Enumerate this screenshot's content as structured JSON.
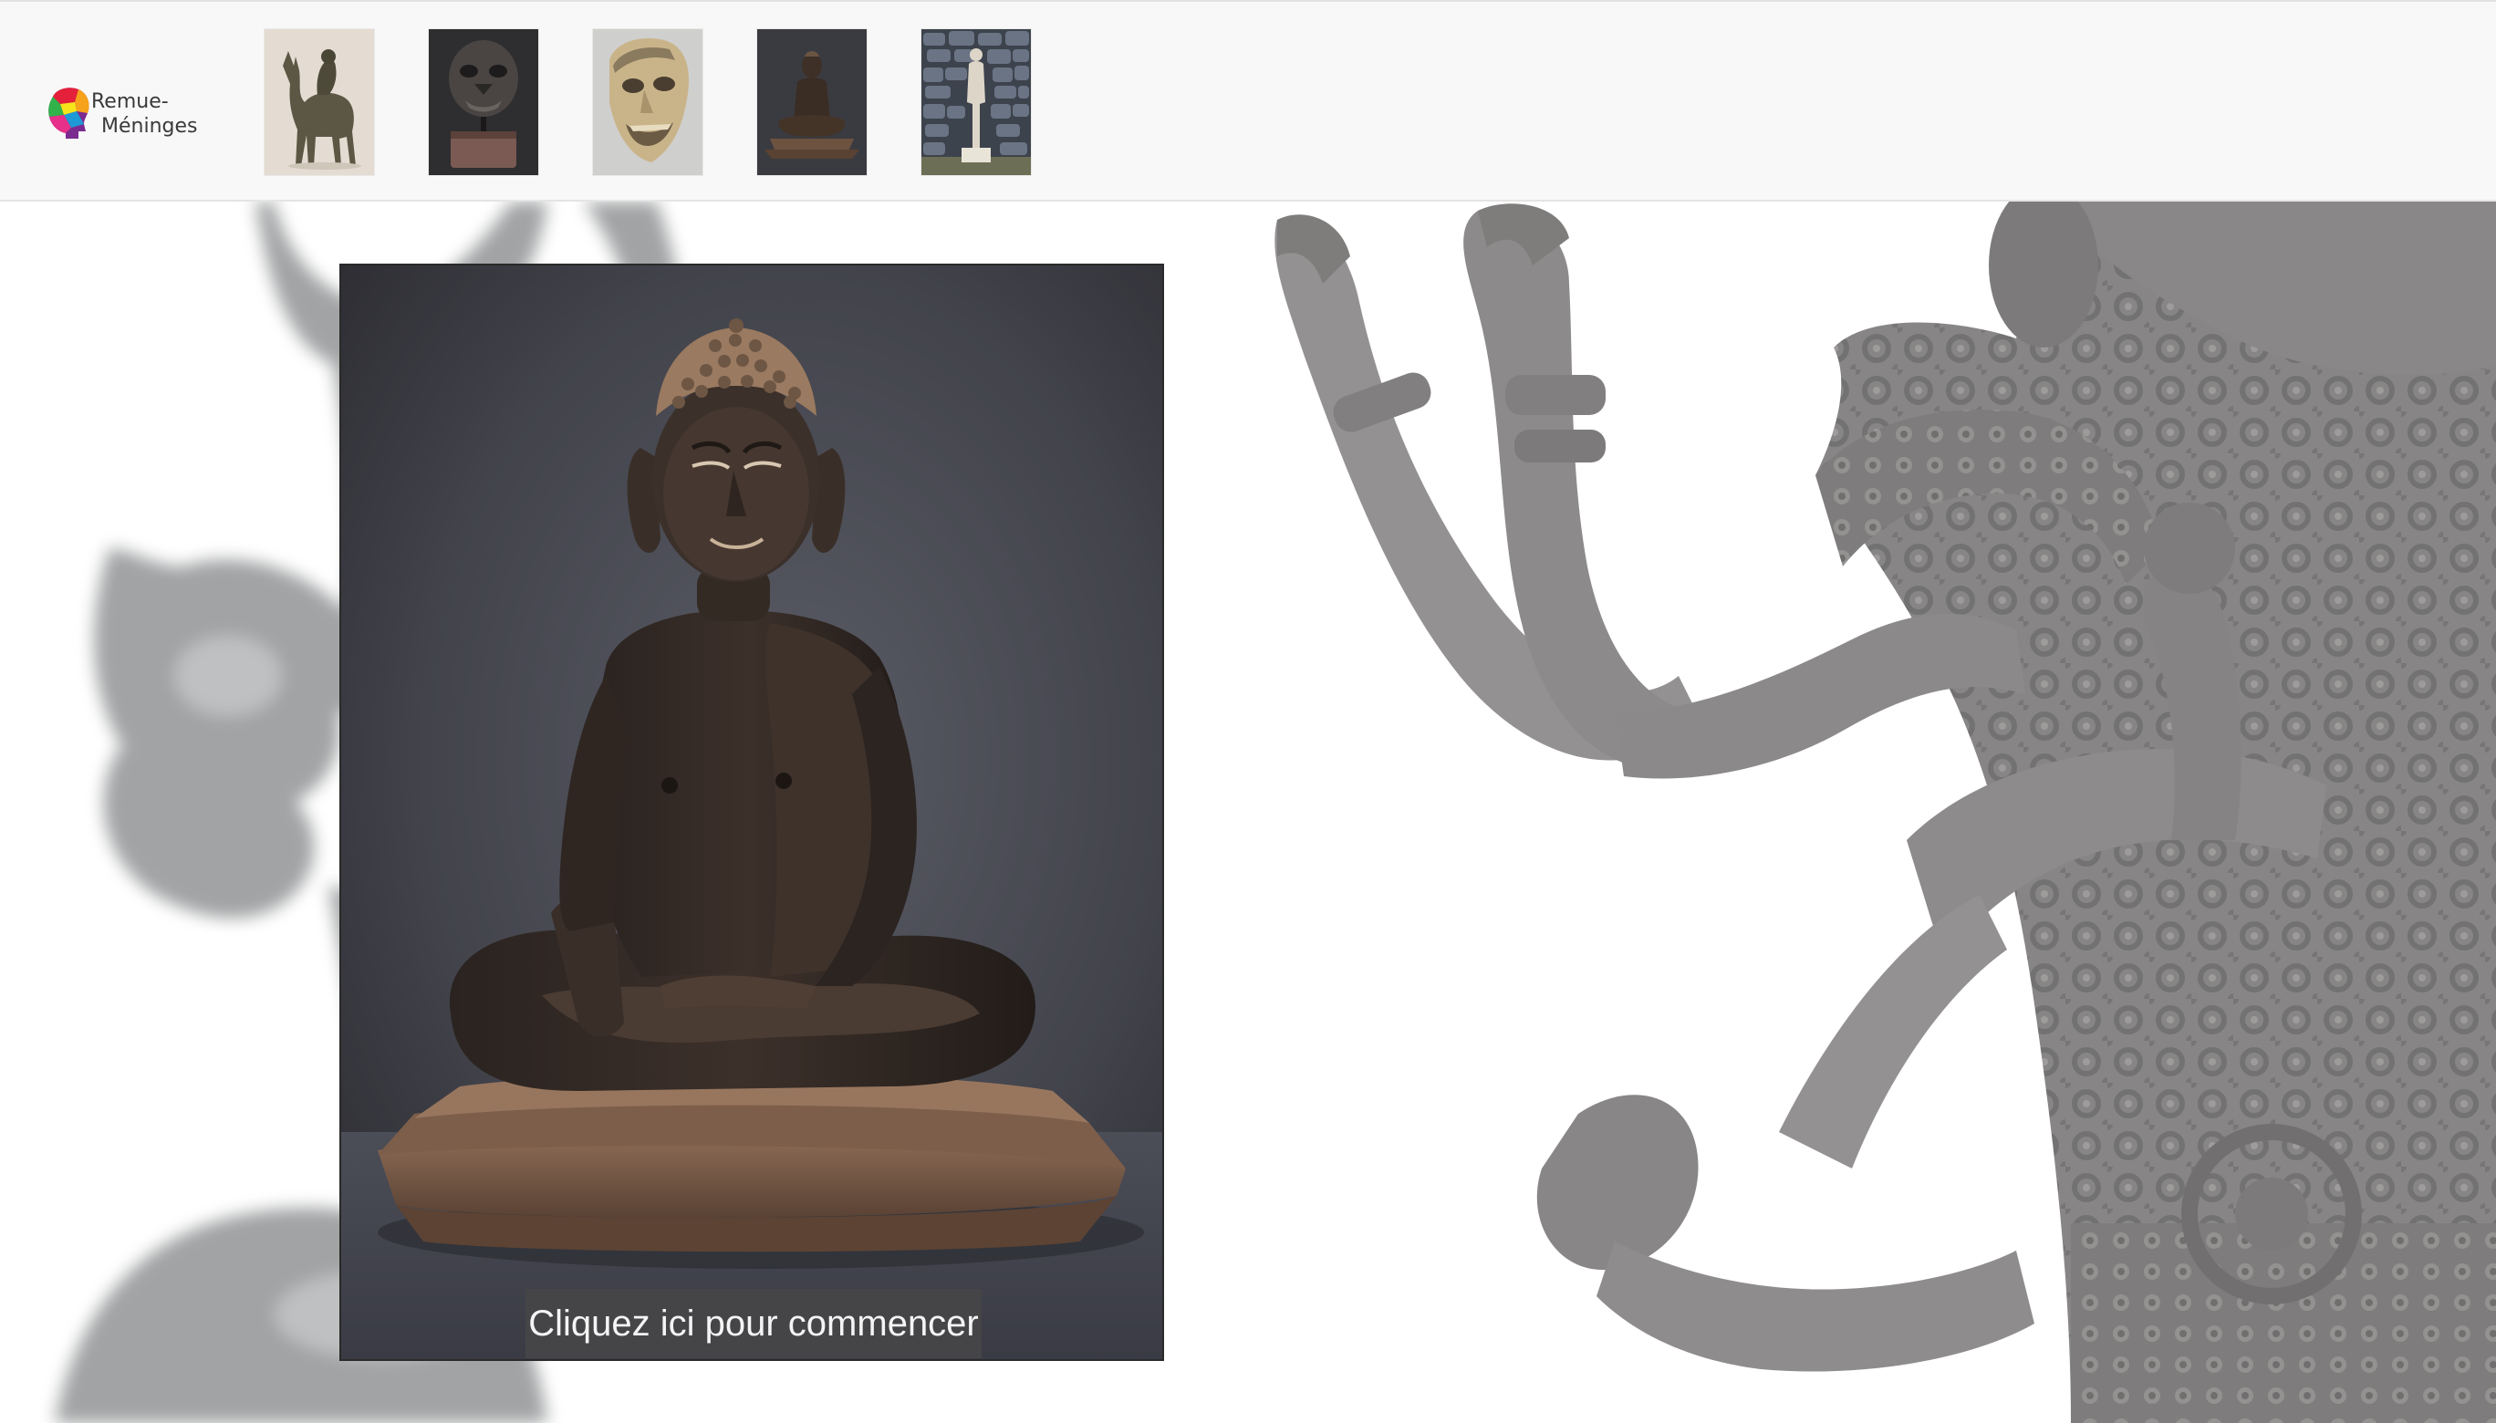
{
  "app": {
    "logo": {
      "line1": "Remue-",
      "line2": "Méninges",
      "colors": [
        "#e5203a",
        "#f7a21b",
        "#f6e51a",
        "#32b34a",
        "#1d9ad6",
        "#7b2a8f",
        "#e6308a"
      ]
    }
  },
  "gallery": {
    "thumbnails": [
      {
        "icon": "camel-rider-statue-thumb"
      },
      {
        "icon": "dark-mask-on-stand-thumb"
      },
      {
        "icon": "pale-carved-mask-thumb"
      },
      {
        "icon": "seated-buddha-thumb"
      },
      {
        "icon": "standing-figure-stone-wall-thumb"
      }
    ]
  },
  "main": {
    "featured": {
      "icon": "seated-bronze-buddha-photo"
    },
    "start_label": "Cliquez ici pour commencer"
  },
  "background": {
    "left": {
      "icon": "blurred-deer-statue"
    },
    "right": {
      "icon": "multi-armed-bronze-deity"
    }
  },
  "colors": {
    "header_bg": "#f8f8f8",
    "card_bg": "#3a3b40",
    "button_bg": "#464648",
    "button_text": "#f4f4f4"
  }
}
